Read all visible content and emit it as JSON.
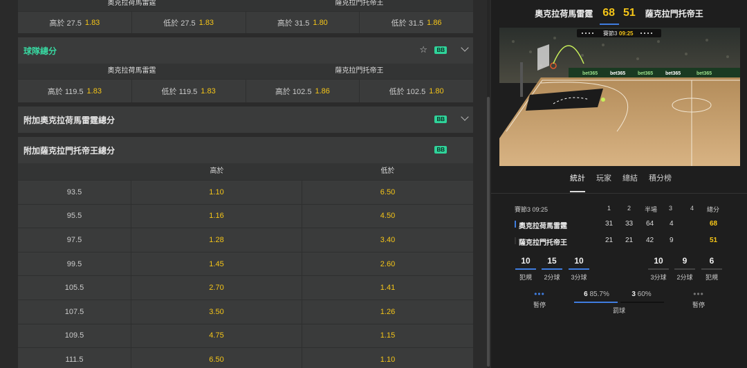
{
  "top_market": {
    "teams": [
      "奧克拉荷馬雷霆",
      "薩克拉門托帝王"
    ],
    "odds": [
      {
        "label": "高於 27.5",
        "value": "1.83"
      },
      {
        "label": "低於 27.5",
        "value": "1.83"
      },
      {
        "label": "高於 31.5",
        "value": "1.80"
      },
      {
        "label": "低於 31.5",
        "value": "1.86"
      }
    ]
  },
  "team_totals": {
    "title": "球隊總分",
    "badge": "BB",
    "teams": [
      "奧克拉荷馬雷霆",
      "薩克拉門托帝王"
    ],
    "odds": [
      {
        "label": "高於 119.5",
        "value": "1.83"
      },
      {
        "label": "低於 119.5",
        "value": "1.83"
      },
      {
        "label": "高於 102.5",
        "value": "1.86"
      },
      {
        "label": "低於 102.5",
        "value": "1.80"
      }
    ]
  },
  "okc_extra": {
    "title": "附加奧克拉荷馬雷霆總分",
    "badge": "BB"
  },
  "sac_extra": {
    "title": "附加薩克拉門托帝王總分",
    "badge": "BB",
    "header_over": "高於",
    "header_under": "低於",
    "rows": [
      {
        "line": "93.5",
        "over": "1.10",
        "under": "6.50"
      },
      {
        "line": "95.5",
        "over": "1.16",
        "under": "4.50"
      },
      {
        "line": "97.5",
        "over": "1.28",
        "under": "3.40"
      },
      {
        "line": "99.5",
        "over": "1.45",
        "under": "2.60"
      },
      {
        "line": "105.5",
        "over": "2.70",
        "under": "1.41"
      },
      {
        "line": "107.5",
        "over": "3.50",
        "under": "1.26"
      },
      {
        "line": "109.5",
        "over": "4.75",
        "under": "1.15"
      },
      {
        "line": "111.5",
        "over": "6.50",
        "under": "1.10"
      }
    ]
  },
  "scoreboard": {
    "home": "奧克拉荷馬雷霆",
    "away": "薩克拉門托帝王",
    "home_score": "68",
    "away_score": "51",
    "period_clock": "賽節3",
    "clock": "09:25",
    "ad_text": "bet365"
  },
  "stat_tabs": [
    "統計",
    "玩家",
    "總結",
    "積分榜"
  ],
  "stats_table": {
    "period": "賽節3",
    "time": "09:25",
    "headers": [
      "1",
      "2",
      "半場",
      "3",
      "4",
      "總分"
    ],
    "rows": [
      {
        "team": "奧克拉荷馬雷霆",
        "q1": "31",
        "q2": "33",
        "half": "64",
        "q3": "4",
        "q4": "",
        "total": "68",
        "color": "#3f7de0"
      },
      {
        "team": "薩克拉門托帝王",
        "q1": "21",
        "q2": "21",
        "half": "42",
        "q3": "9",
        "q4": "",
        "total": "51",
        "color": "#111111"
      }
    ]
  },
  "big_stats": {
    "home": [
      {
        "n": "10",
        "l": "犯規"
      },
      {
        "n": "15",
        "l": "2分球"
      },
      {
        "n": "10",
        "l": "3分球"
      }
    ],
    "away": [
      {
        "n": "10",
        "l": "3分球"
      },
      {
        "n": "9",
        "l": "2分球"
      },
      {
        "n": "6",
        "l": "犯規"
      }
    ]
  },
  "bottom_stats": {
    "home_timeout": "暫停",
    "away_timeout": "暫停",
    "ft_label": "罰球",
    "home_ft": "6",
    "home_ft_pct": "85.7%",
    "away_ft": "3",
    "away_ft_pct": "60%"
  }
}
